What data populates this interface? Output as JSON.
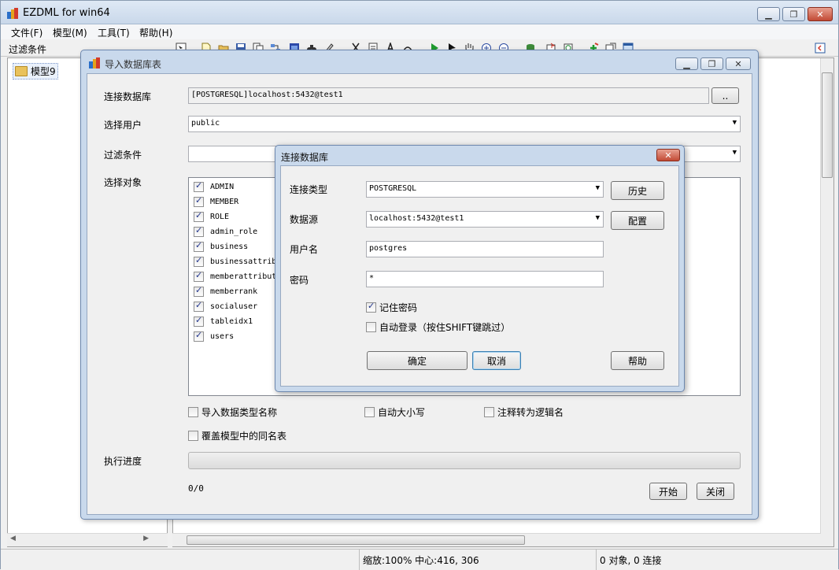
{
  "app": {
    "title": "EZDML for win64"
  },
  "menu": [
    "文件(F)",
    "模型(M)",
    "工具(T)",
    "帮助(H)"
  ],
  "left_panel": {
    "filter_label": "过滤条件",
    "tree_node": "模型9"
  },
  "status": {
    "zoom_center": "缩放:100% 中心:416, 306",
    "counts": "0 对象, 0 连接"
  },
  "import_dialog": {
    "title": "导入数据库表",
    "labels": {
      "connect_db": "连接数据库",
      "select_user": "选择用户",
      "filter": "过滤条件",
      "select_objects": "选择对象",
      "progress": "执行进度"
    },
    "connect_value": "[POSTGRESQL]localhost:5432@test1",
    "browse_button": "..",
    "user_value": "public",
    "filter_value": "",
    "objects": [
      {
        "name": "ADMIN",
        "checked": true
      },
      {
        "name": "MEMBER",
        "checked": true
      },
      {
        "name": "ROLE",
        "checked": true
      },
      {
        "name": "admin_role",
        "checked": true
      },
      {
        "name": "business",
        "checked": true
      },
      {
        "name": "businessattrib",
        "checked": true
      },
      {
        "name": "memberattribut",
        "checked": true
      },
      {
        "name": "memberrank",
        "checked": true
      },
      {
        "name": "socialuser",
        "checked": true
      },
      {
        "name": "tableidx1",
        "checked": true
      },
      {
        "name": "users",
        "checked": true
      }
    ],
    "options": {
      "import_type_names": "导入数据类型名称",
      "auto_case": "自动大小写",
      "comment_to_logic": "注释转为逻辑名",
      "overwrite_same": "覆盖模型中的同名表"
    },
    "progress_fraction": 0,
    "progress_text": "0/0",
    "start_button": "开始",
    "close_button": "关闭"
  },
  "connect_dialog": {
    "title": "连接数据库",
    "close_glyph": "✕",
    "labels": {
      "type": "连接类型",
      "source": "数据源",
      "username": "用户名",
      "password": "密码"
    },
    "type_value": "POSTGRESQL",
    "source_value": "localhost:5432@test1",
    "username_value": "postgres",
    "password_value": "*",
    "history_button": "历史",
    "config_button": "配置",
    "remember_password": "记住密码",
    "auto_login": "自动登录（按住SHIFT键跳过）",
    "ok_button": "确定",
    "cancel_button": "取消",
    "help_button": "帮助"
  }
}
